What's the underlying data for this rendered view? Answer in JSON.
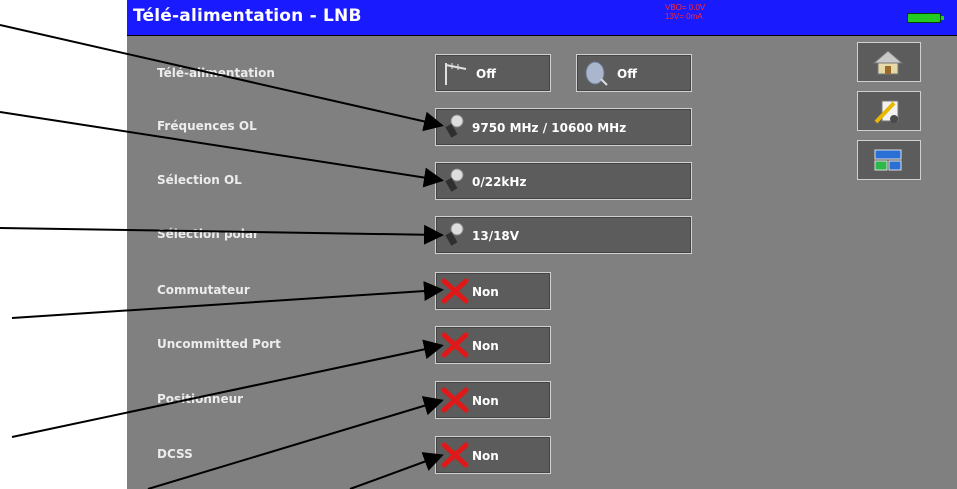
{
  "header": {
    "title": "Télé-alimentation - LNB",
    "status_line1": "VBO= 0.0V",
    "status_line2": "13V= 0mA",
    "battery_color": "#22cc22"
  },
  "rows": [
    {
      "label": "Télé-alimentation",
      "buttons": [
        {
          "value": "Off",
          "icon": "terrestrial-antenna-icon"
        },
        {
          "value": "Off",
          "icon": "satellite-dish-icon"
        }
      ]
    },
    {
      "label": "Fréquences OL",
      "value": "9750 MHz / 10600 MHz",
      "icon": "lnb-icon"
    },
    {
      "label": "Sélection OL",
      "value": "0/22kHz",
      "icon": "lnb-icon"
    },
    {
      "label": "Sélection polar",
      "value": "13/18V",
      "icon": "lnb-icon"
    },
    {
      "label": "Commutateur",
      "value": "Non",
      "icon": "red-x-icon"
    },
    {
      "label": "Uncommitted Port",
      "value": "Non",
      "icon": "red-x-icon"
    },
    {
      "label": "Positionneur",
      "value": "Non",
      "icon": "red-x-icon"
    },
    {
      "label": "DCSS",
      "value": "Non",
      "icon": "red-x-icon"
    }
  ],
  "side_buttons": [
    "home-icon",
    "edit-settings-icon",
    "display-config-icon"
  ],
  "colors": {
    "title_bar": "#1a1aff",
    "panel": "#808080",
    "button": "#5c5c5c",
    "x_red": "#e01818"
  }
}
